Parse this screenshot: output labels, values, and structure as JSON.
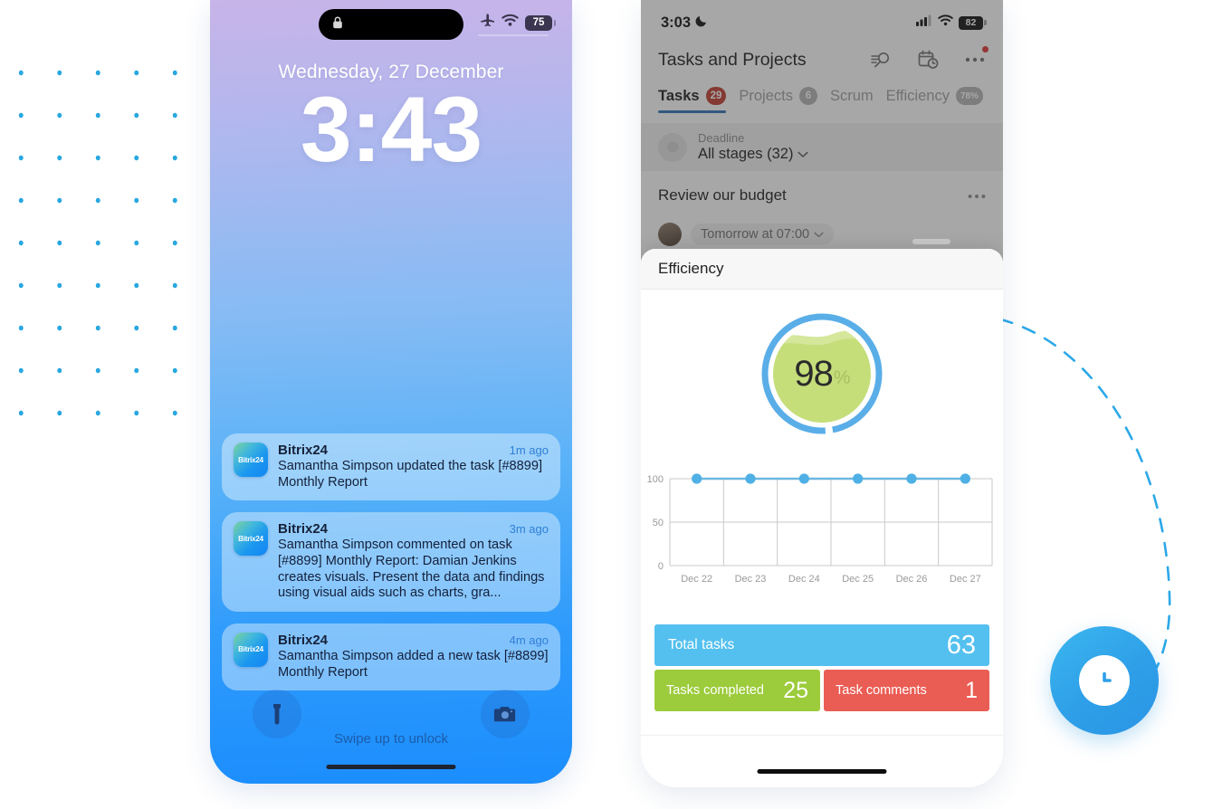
{
  "decor": {
    "dot_color": "#29a8e0",
    "arc_color": "#2ba8e8",
    "clock_badge_icon": "clock-icon"
  },
  "left_phone": {
    "status": {
      "lock_icon": "lock-icon",
      "airplane_icon": "airplane-mode-icon",
      "wifi_icon": "wifi-icon",
      "battery": "75"
    },
    "lock_screen": {
      "date": "Wednesday, 27 December",
      "time": "3:43",
      "swipe_hint": "Swipe up to unlock",
      "flashlight_icon": "flashlight-icon",
      "camera_icon": "camera-icon"
    },
    "notifications": [
      {
        "app": "Bitrix24",
        "icon_label": "Bitrix24",
        "time": "1m ago",
        "text": "Samantha Simpson updated the task [#8899] Monthly Report"
      },
      {
        "app": "Bitrix24",
        "icon_label": "Bitrix24",
        "time": "3m ago",
        "text": "Samantha Simpson commented on task [#8899] Monthly Report: Damian Jenkins creates visuals. Present the data and findings using visual aids such as charts, gra..."
      },
      {
        "app": "Bitrix24",
        "icon_label": "Bitrix24",
        "time": "4m ago",
        "text": "Samantha Simpson added a new task [#8899] Monthly Report"
      }
    ]
  },
  "right_phone": {
    "status": {
      "time": "3:03",
      "moon_icon": "moon-icon",
      "cellular_icon": "cellular-signal-icon",
      "wifi_icon": "wifi-icon",
      "battery": "82"
    },
    "header": {
      "title": "Tasks and Projects",
      "search_icon": "search-filter-icon",
      "calendar_icon": "calendar-clock-icon",
      "more_icon": "more-options-icon"
    },
    "tabs": [
      {
        "label": "Tasks",
        "badge": "29",
        "active": true
      },
      {
        "label": "Projects",
        "badge": "6",
        "active": false
      },
      {
        "label": "Scrum",
        "badge": "",
        "active": false
      },
      {
        "label": "Efficiency",
        "badge": "78%",
        "active": false
      }
    ],
    "filter": {
      "label": "Deadline",
      "value": "All stages (32)",
      "chevron_icon": "chevron-down-icon",
      "avatar_icon": "group-avatar-icon"
    },
    "task": {
      "title": "Review our budget",
      "more_icon": "more-options-icon",
      "deadline_chip": "Tomorrow at 07:00",
      "chevron_icon": "chevron-down-icon"
    },
    "sheet": {
      "title": "Efficiency",
      "gauge": {
        "value": "98",
        "unit": "%",
        "ring_color": "#5aaee8",
        "fill_color": "#c5de7a"
      },
      "stats": [
        {
          "label": "Total tasks",
          "value": "63",
          "color": "#54c0ef"
        },
        {
          "label": "Tasks completed",
          "value": "25",
          "color": "#9ccb3b"
        },
        {
          "label": "Task comments",
          "value": "1",
          "color": "#ea5d54"
        }
      ]
    }
  },
  "chart_data": {
    "type": "line",
    "title": "Efficiency",
    "x": [
      "Dec 22",
      "Dec 23",
      "Dec 24",
      "Dec 25",
      "Dec 26",
      "Dec 27"
    ],
    "values": [
      100,
      100,
      100,
      100,
      100,
      100
    ],
    "ylim": [
      0,
      100
    ],
    "yticks": [
      0,
      50,
      100
    ],
    "ytick_labels": [
      "0",
      "50",
      "100"
    ],
    "xlabel": "",
    "ylabel": "",
    "grid": true,
    "line_color": "#6cb7e0",
    "marker_color": "#4fb0e5",
    "legend": null
  }
}
